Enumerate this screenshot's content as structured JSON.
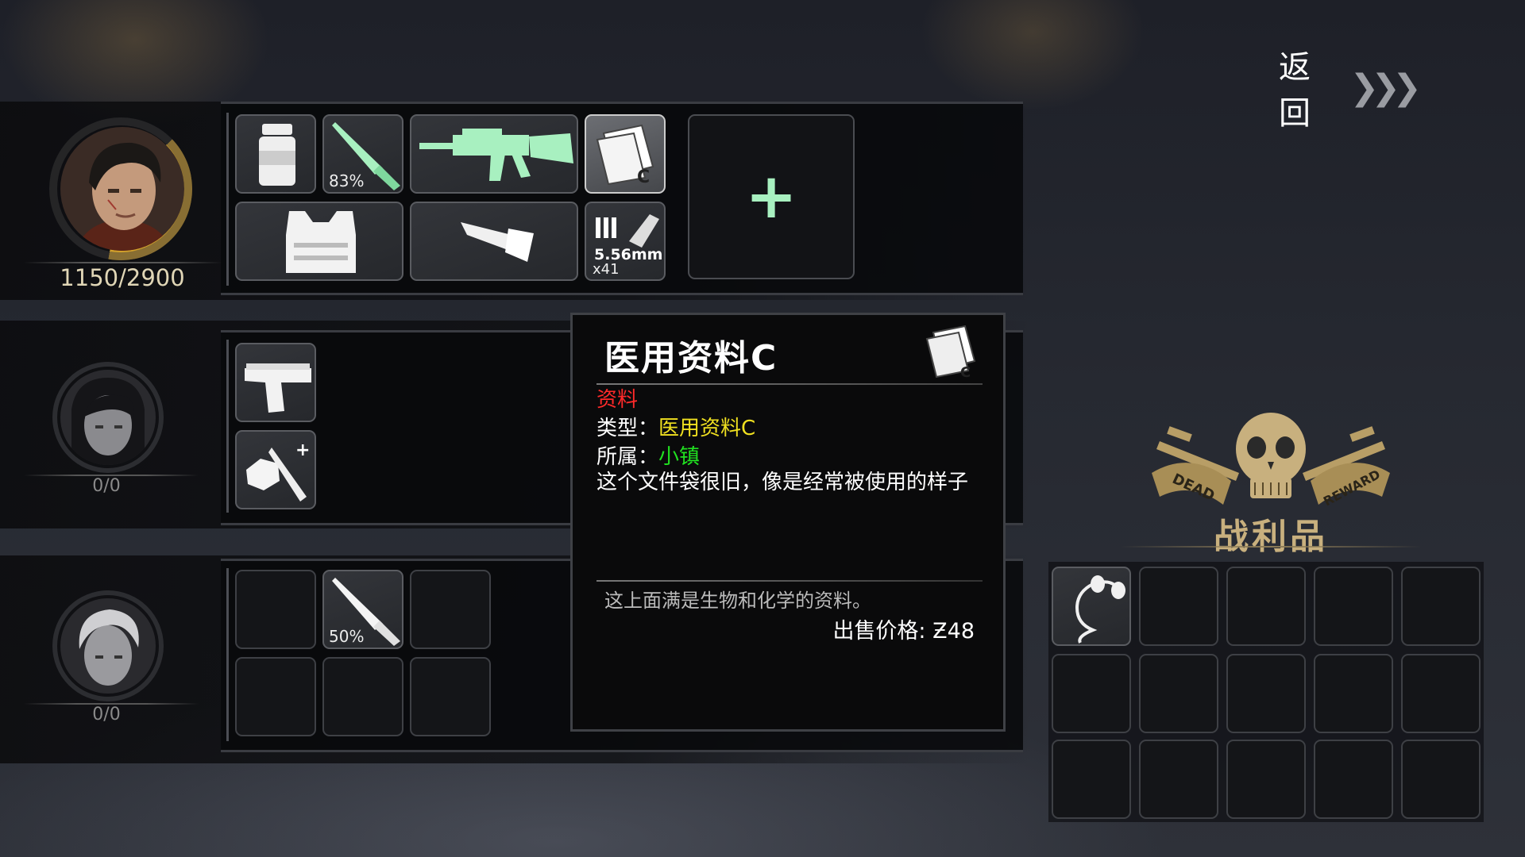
{
  "nav": {
    "back_label": "返回",
    "back_chevrons": "❯❯❯"
  },
  "characters": [
    {
      "name_id": "survivor-male-lead",
      "hp": "1150/2900",
      "hp_fraction": 0.397
    },
    {
      "name_id": "survivor-female",
      "hp": "0/0"
    },
    {
      "name_id": "survivor-male-blond",
      "hp": "0/0"
    }
  ],
  "slots": {
    "char1": [
      {
        "icon": "pill-bottle-icon"
      },
      {
        "icon": "knife-icon",
        "durability": "83%"
      },
      {
        "icon": "assault-rifle-icon"
      },
      {
        "icon": "document-c-icon",
        "selected": true
      },
      {
        "icon": "body-armor-icon"
      },
      {
        "icon": "flashlight-icon"
      },
      {
        "icon": "ammo-icon",
        "caliber": "5.56mm",
        "quantity": "x41"
      }
    ],
    "char1_add_symbol": "+",
    "char2": [
      {
        "icon": "pistol-icon"
      },
      {
        "icon": "food-knife-icon"
      }
    ],
    "char3": [
      {
        "icon": "knife-icon",
        "durability": "50%"
      }
    ]
  },
  "tooltip": {
    "title": "医用资料C",
    "category": "资料",
    "type_label": "类型：",
    "type_value": "医用资料C",
    "faction_label": "所属：",
    "faction_value": "小镇",
    "description": "这个文件袋很旧，像是经常被使用的样子",
    "note": "这上面满是生物和化学的资料。",
    "price_label": "出售价格:",
    "price_currency": "Ƶ",
    "price_value": "48",
    "colors": {
      "category": "#ff2a2a",
      "type_value": "#f0e020",
      "faction_value": "#20e020"
    }
  },
  "loot": {
    "title": "战利品",
    "emblem_left": "DEAD",
    "emblem_right": "REWARD",
    "items": [
      {
        "icon": "earphones-icon"
      }
    ]
  }
}
